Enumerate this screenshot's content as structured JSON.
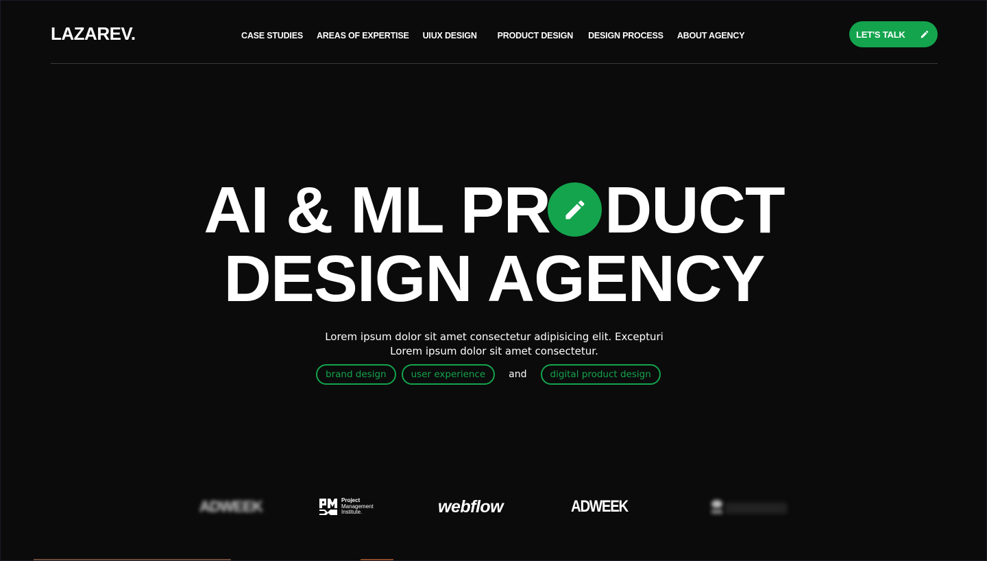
{
  "header": {
    "logo": "LAZAREV.",
    "nav": [
      {
        "label": "CASE STUDIES"
      },
      {
        "label": "AREAS OF EXPERTISE"
      },
      {
        "label": "UIUX DESIGN"
      },
      {
        "label": "PRODUCT DESIGN"
      },
      {
        "label": "DESIGN PROCESS"
      },
      {
        "label": "ABOUT AGENCY"
      }
    ],
    "cta_label": "LET'S TALK",
    "cta_icon": "pencil-icon"
  },
  "hero": {
    "line1_before": "AI & ML PR",
    "line1_after": "DUCT",
    "line2": "DESIGN AGENCY",
    "o_icon": "pencil-icon",
    "subtitle_line1": "Lorem ipsum dolor sit amet consectetur adipisicing elit. Excepturi",
    "subtitle_line2": "Lorem ipsum dolor sit amet consectetur.",
    "tags": [
      "brand design",
      "user experience",
      "digital product design"
    ],
    "and_text": "and"
  },
  "logos": {
    "item1": "ADWEEK",
    "pmi_line1": "Project",
    "pmi_line2": "Management",
    "pmi_line3": "Institute.",
    "webflow": "webflow",
    "adweek": "ADWEEK"
  },
  "colors": {
    "accent": "#14a44d",
    "background": "#0b0b0b",
    "text": "#ffffff"
  }
}
